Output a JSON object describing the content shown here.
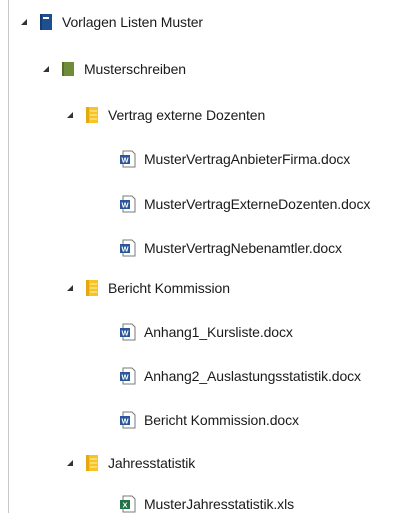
{
  "tree": {
    "notebook": {
      "label": "Vorlagen Listen Muster",
      "icon": "notebook-icon"
    },
    "section_group": {
      "label": "Musterschreiben",
      "icon": "section-group-icon"
    },
    "folders": [
      {
        "label": "Vertrag externe Dozenten",
        "icon": "section-icon",
        "files": [
          {
            "label": "MusterVertragAnbieterFirma.docx",
            "icon": "word-doc-icon"
          },
          {
            "label": "MusterVertragExterneDozenten.docx",
            "icon": "word-doc-icon"
          },
          {
            "label": "MusterVertragNebenamtler.docx",
            "icon": "word-doc-icon"
          }
        ]
      },
      {
        "label": "Bericht Kommission",
        "icon": "section-icon",
        "files": [
          {
            "label": "Anhang1_Kursliste.docx",
            "icon": "word-doc-icon"
          },
          {
            "label": "Anhang2_Auslastungsstatistik.docx",
            "icon": "word-doc-icon"
          },
          {
            "label": "Bericht Kommission.docx",
            "icon": "word-doc-icon"
          }
        ]
      },
      {
        "label": "Jahresstatistik",
        "icon": "section-icon",
        "files": [
          {
            "label": "MusterJahresstatistik.xls",
            "icon": "excel-doc-icon"
          }
        ]
      }
    ]
  },
  "colors": {
    "notebook": "#1e4f91",
    "section_group": "#6f8c3a",
    "section": "#f7c325",
    "word": "#2b579a",
    "excel": "#217346"
  }
}
